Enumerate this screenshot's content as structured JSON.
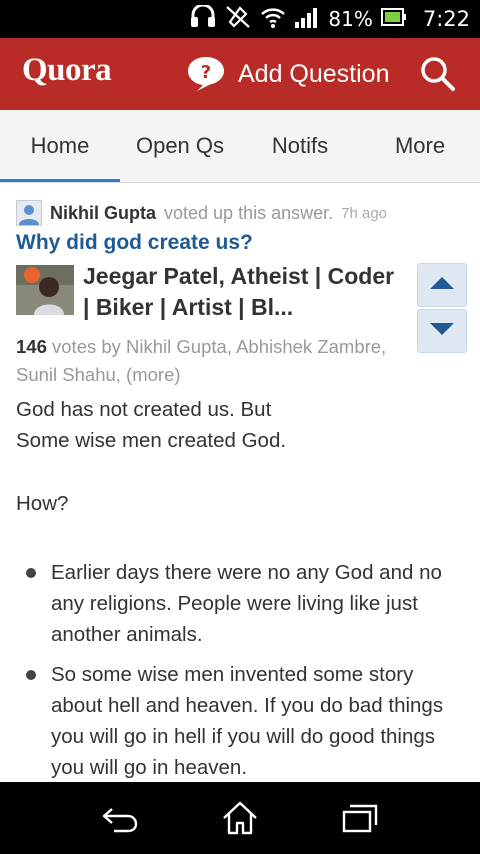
{
  "status_bar": {
    "battery": "81%",
    "time": "7:22",
    "icons": [
      "headset-icon",
      "mute-icon",
      "wifi-icon",
      "signal-icon",
      "battery-icon"
    ]
  },
  "app_bar": {
    "logo": "Quora",
    "add_question_label": "Add Question",
    "icons": [
      "question-bubble-icon",
      "search-icon"
    ],
    "color": "#b92b27"
  },
  "tabs": [
    {
      "label": "Home",
      "active": true
    },
    {
      "label": "Open Qs",
      "active": false
    },
    {
      "label": "Notifs",
      "active": false
    },
    {
      "label": "More",
      "active": false
    }
  ],
  "feed_item": {
    "actor": "Nikhil Gupta",
    "action": "voted up this answer.",
    "time": "7h ago",
    "question": "Why did god create us?",
    "author": "Jeegar Patel, Atheist | Coder | Biker | Artist | Bl...",
    "vote_count": "146",
    "votes_text": "votes by Nikhil Gupta, Abhishek Zambre, Sunil Shahu, (more)",
    "answer": {
      "p1": "God has not created us. But",
      "p2": "Some wise men created God.",
      "p3": "How?",
      "bullets": [
        "Earlier days there were no any God and no any religions. People were living like just another animals.",
        "So some wise men invented some story about hell and heaven. If you do bad things you will go in hell if you will do good things you will go in heaven."
      ]
    }
  },
  "nav_bar": {
    "icons": [
      "back-icon",
      "home-icon",
      "recent-apps-icon"
    ]
  }
}
